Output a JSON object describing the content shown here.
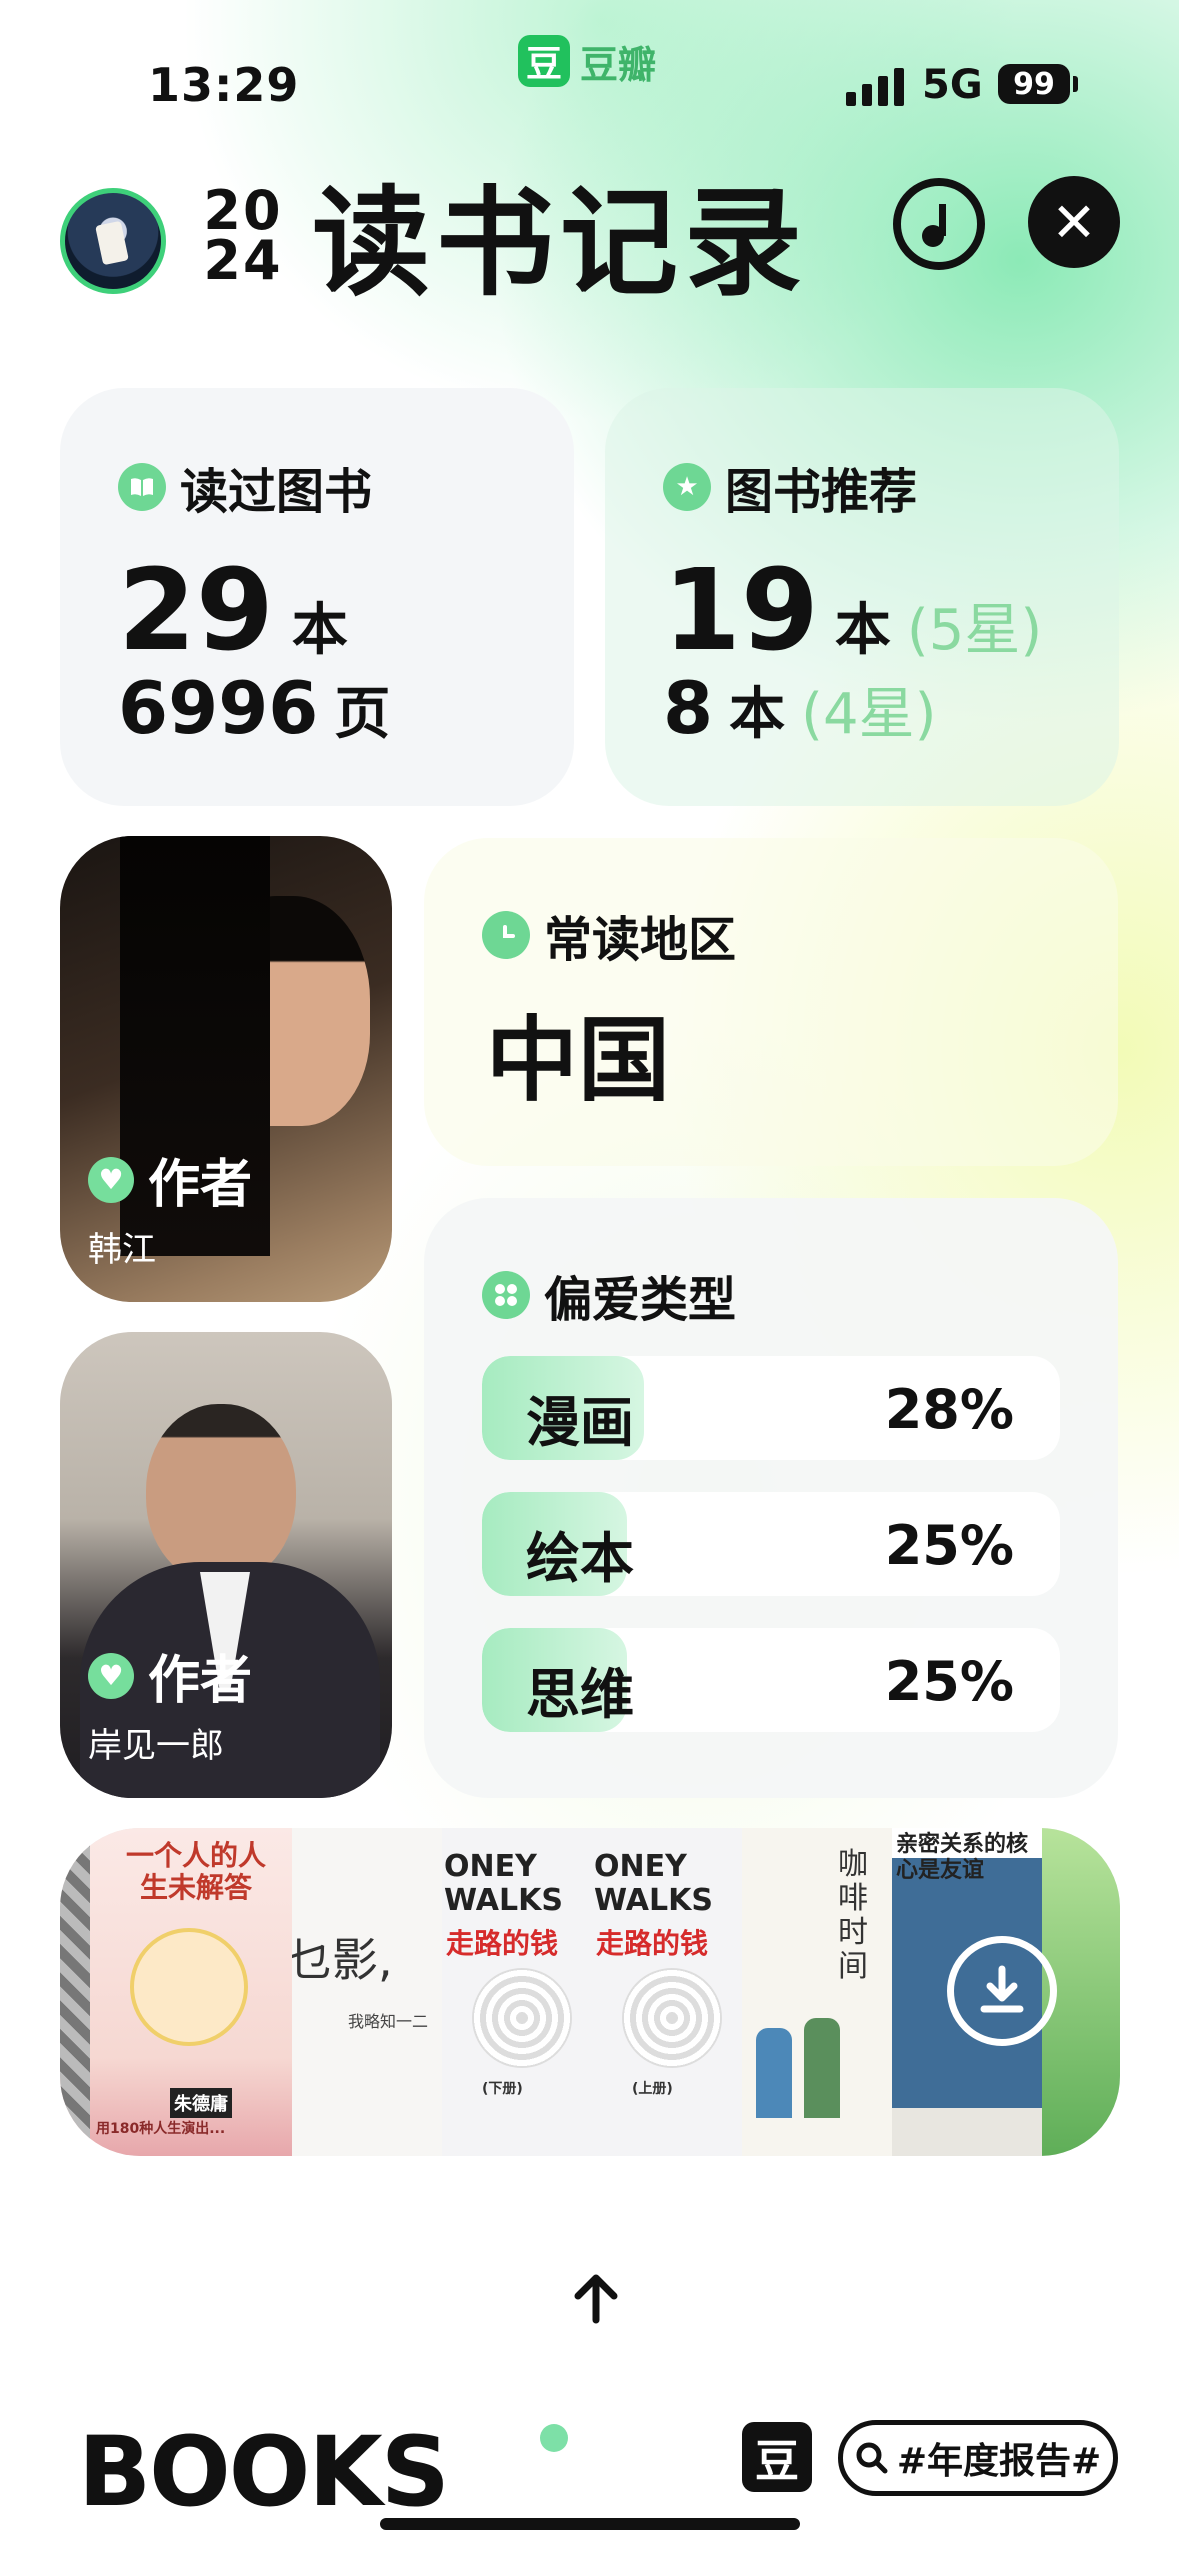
{
  "status_bar": {
    "time": "13:29",
    "brand": "豆瓣",
    "brand_logo": "豆",
    "network": "5G",
    "battery": "99"
  },
  "header": {
    "year_top": "20",
    "year_bottom": "24",
    "title": "读书记录"
  },
  "read_card": {
    "label": "读过图书",
    "books_count": "29",
    "books_unit": "本",
    "pages_count": "6996",
    "pages_unit": "页"
  },
  "recommend_card": {
    "label": "图书推荐",
    "five_star_count": "19",
    "five_star_unit": "本",
    "five_star_note": "(5星)",
    "four_star_count": "8",
    "four_star_unit": "本",
    "four_star_note": "(4星)"
  },
  "region_card": {
    "label": "常读地区",
    "value": "中国"
  },
  "genre_card": {
    "label": "偏爱类型",
    "items": [
      {
        "name": "漫画",
        "percent": "28%",
        "fraction": 0.28
      },
      {
        "name": "绘本",
        "percent": "25%",
        "fraction": 0.25
      },
      {
        "name": "思维",
        "percent": "25%",
        "fraction": 0.25
      }
    ]
  },
  "authors": [
    {
      "tag": "作者",
      "name": "韩江"
    },
    {
      "tag": "作者",
      "name": "岸见一郎"
    }
  ],
  "covers": [
    {
      "title": "一个人的人生未解答",
      "subtitle": "朱德庸",
      "tagline": "用180种人生演出..."
    },
    {
      "title": "乜影,",
      "subtitle": "我略知一二"
    },
    {
      "title": "ONEY WALKS",
      "subtitle": "走路的钱",
      "vol": "(下册)"
    },
    {
      "title": "ONEY WALKS",
      "subtitle": "走路的钱",
      "vol": "(上册)"
    },
    {
      "title": "咖啡时间"
    },
    {
      "title": "亲密关系的核心是友谊"
    },
    {
      "title": ""
    }
  ],
  "footer": {
    "books_logo": "BOOKS",
    "douban_icon": "豆",
    "hashtag": "#年度报告#"
  },
  "colors": {
    "accent_green": "#6ed794",
    "dark": "#111111",
    "note_green": "#8ad9a0"
  }
}
